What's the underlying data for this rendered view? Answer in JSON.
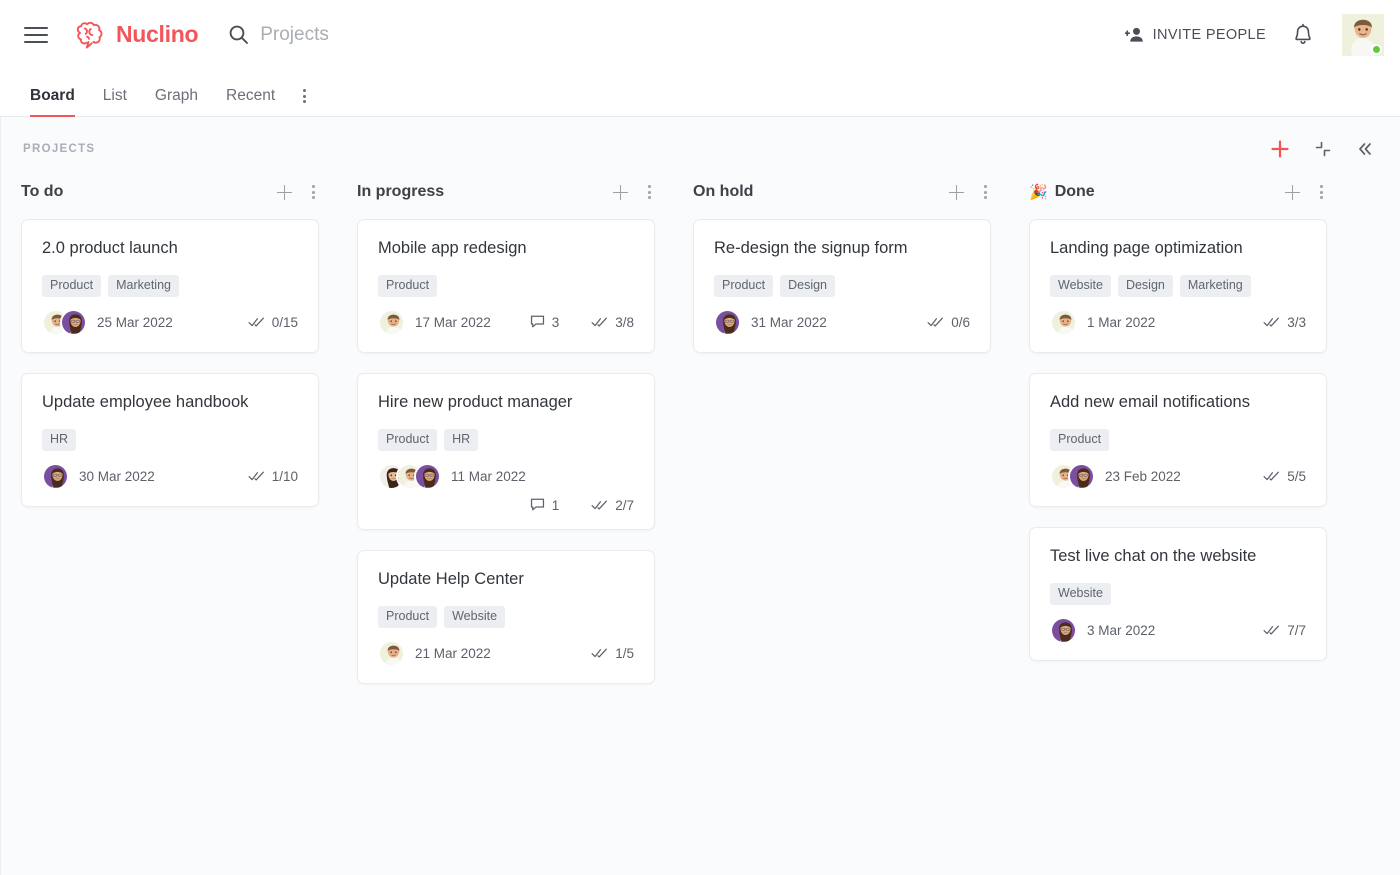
{
  "app": {
    "brand_name": "Nuclino",
    "brand_color": "#f4555a"
  },
  "header": {
    "menu_icon": "hamburger-menu-icon",
    "logo_icon": "nuclino-brain-logo",
    "search": {
      "icon": "search-icon",
      "value": "",
      "placeholder": "Projects"
    },
    "invite_label": "INVITE PEOPLE",
    "invite_icon": "add-person-icon",
    "notifications_icon": "bell-icon",
    "avatar": {
      "name": "user-avatar",
      "status": "online",
      "status_color": "#5fcb3c",
      "bg": "#eef0dd",
      "type": "man"
    }
  },
  "tabs": [
    {
      "label": "Board",
      "active": true
    },
    {
      "label": "List",
      "active": false
    },
    {
      "label": "Graph",
      "active": false
    },
    {
      "label": "Recent",
      "active": false
    }
  ],
  "tabs_more_icon": "more-options-icon",
  "board": {
    "title": "PROJECTS",
    "actions": [
      {
        "name": "add-item-button",
        "icon": "plus-icon",
        "color": "#f4555a"
      },
      {
        "name": "collapse-all-button",
        "icon": "collapse-arrows-icon",
        "color": "#5c616a"
      },
      {
        "name": "hide-sidebar-button",
        "icon": "double-chevron-left-icon",
        "color": "#5c616a"
      }
    ],
    "column_add_icon": "plus-icon",
    "column_menu_icon": "more-options-icon",
    "columns": [
      {
        "title": "To do",
        "emoji": "",
        "cards": [
          {
            "title": "2.0 product launch",
            "tags": [
              "Product",
              "Marketing"
            ],
            "avatars": [
              "man-cream",
              "woman-purple"
            ],
            "date": "25 Mar 2022",
            "comments": null,
            "tasks": "0/15"
          },
          {
            "title": "Update employee handbook",
            "tags": [
              "HR"
            ],
            "avatars": [
              "woman-purple"
            ],
            "date": "30 Mar 2022",
            "comments": null,
            "tasks": "1/10"
          }
        ]
      },
      {
        "title": "In progress",
        "emoji": "",
        "cards": [
          {
            "title": "Mobile app redesign",
            "tags": [
              "Product"
            ],
            "avatars": [
              "man-cream"
            ],
            "date": "17 Mar 2022",
            "comments": "3",
            "tasks": "3/8"
          },
          {
            "title": "Hire new product manager",
            "tags": [
              "Product",
              "HR"
            ],
            "avatars": [
              "woman-dark",
              "man-cream",
              "woman-purple"
            ],
            "date": "11 Mar 2022",
            "comments": "1",
            "tasks": "2/7",
            "wrap_meta": true
          },
          {
            "title": "Update Help Center",
            "tags": [
              "Product",
              "Website"
            ],
            "avatars": [
              "man-cream"
            ],
            "date": "21 Mar 2022",
            "comments": null,
            "tasks": "1/5"
          }
        ]
      },
      {
        "title": "On hold",
        "emoji": "",
        "cards": [
          {
            "title": "Re-design the signup form",
            "tags": [
              "Product",
              "Design"
            ],
            "avatars": [
              "woman-purple"
            ],
            "date": "31 Mar 2022",
            "comments": null,
            "tasks": "0/6"
          }
        ]
      },
      {
        "title": "Done",
        "emoji": "🎉",
        "cards": [
          {
            "title": "Landing page optimization",
            "tags": [
              "Website",
              "Design",
              "Marketing"
            ],
            "avatars": [
              "man-cream"
            ],
            "date": "1 Mar 2022",
            "comments": null,
            "tasks": "3/3"
          },
          {
            "title": "Add new email notifications",
            "tags": [
              "Product"
            ],
            "avatars": [
              "man-cream",
              "woman-purple"
            ],
            "date": "23 Feb 2022",
            "comments": null,
            "tasks": "5/5"
          },
          {
            "title": "Test live chat on the website",
            "tags": [
              "Website"
            ],
            "avatars": [
              "woman-purple"
            ],
            "date": "3 Mar 2022",
            "comments": null,
            "tasks": "7/7"
          }
        ]
      }
    ]
  },
  "icons": {
    "comment": "comment-bubble-icon",
    "tasks": "double-check-icon"
  }
}
